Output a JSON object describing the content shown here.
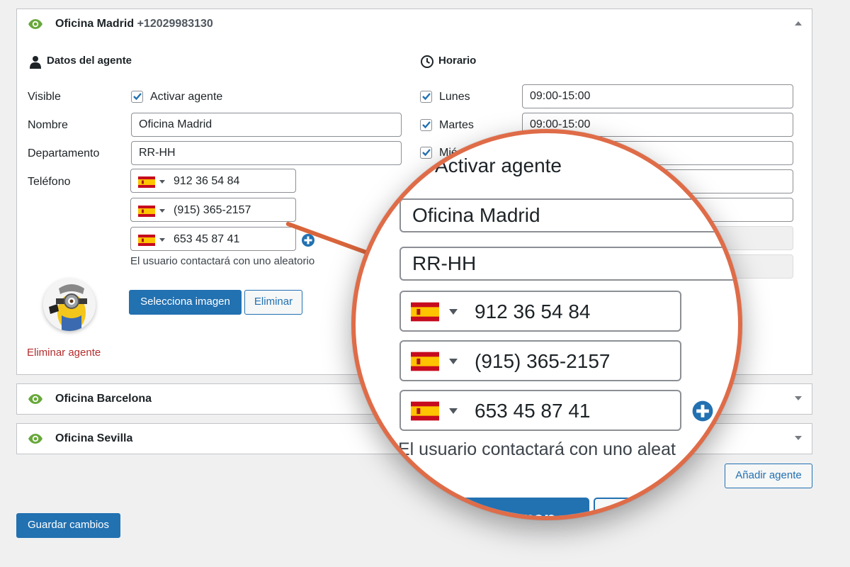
{
  "agents": [
    {
      "name": "Oficina Madrid",
      "phone": "+12029983130",
      "expanded": true
    },
    {
      "name": "Oficina Barcelona",
      "expanded": false
    },
    {
      "name": "Oficina Sevilla",
      "expanded": false
    }
  ],
  "agent_data": {
    "section_title": "Datos del agente",
    "visible_label": "Visible",
    "visible_checkbox_label": "Activar agente",
    "visible_checked": true,
    "name_label": "Nombre",
    "name_value": "Oficina Madrid",
    "department_label": "Departamento",
    "department_value": "RR-HH",
    "phone_label": "Teléfono",
    "phones": [
      {
        "country": "ES",
        "number": "912 36 54 84"
      },
      {
        "country": "ES",
        "number": "(915) 365-2157"
      },
      {
        "country": "ES",
        "number": "653 45 87 41"
      }
    ],
    "random_note": "El usuario contactará con uno aleatorio",
    "select_image_button": "Selecciona imagen",
    "remove_image_button": "Eliminar",
    "delete_agent_link": "Eliminar agente"
  },
  "schedule": {
    "section_title": "Horario",
    "days": [
      {
        "label": "Lunes",
        "checked": true,
        "hours": "09:00-15:00",
        "enabled": true
      },
      {
        "label": "Martes",
        "checked": true,
        "hours": "09:00-15:00",
        "enabled": true
      },
      {
        "label": "Mié",
        "checked": true,
        "hours": "",
        "enabled": true
      }
    ]
  },
  "magnifier": {
    "visible_checkbox_label": "Activar agente",
    "name_value": "Oficina Madrid",
    "department_value": "RR-HH",
    "phones": [
      "912 36 54 84",
      "(915) 365-2157",
      "653 45 87 41"
    ],
    "note": "El usuario contactará con uno aleat",
    "button_partial": "imagen"
  },
  "add_agent_button": "Añadir agente",
  "save_button": "Guardar cambios",
  "colors": {
    "primary": "#2271b1",
    "eye_green": "#68a83b",
    "danger": "#b32d2e",
    "magnifier_border": "#df6c48"
  },
  "icons": {
    "visibility": "eye-icon",
    "agent_section": "user-icon",
    "schedule_section": "clock-icon",
    "add_phone": "plus-circle-icon",
    "collapse": "triangle-up-icon",
    "expand": "triangle-down-icon",
    "flag": "spain-flag-icon"
  }
}
